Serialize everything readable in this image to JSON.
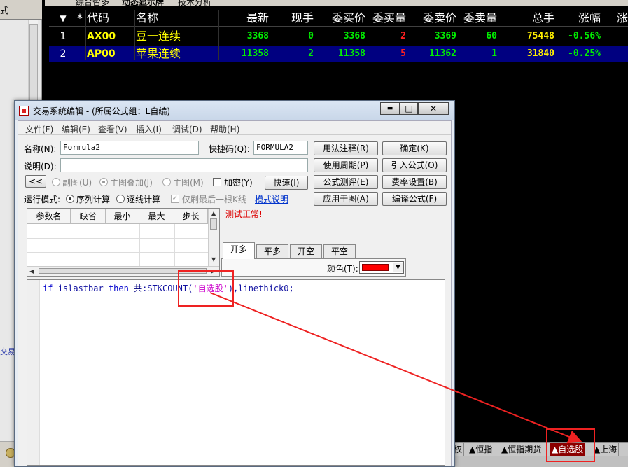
{
  "left_panel": {
    "top_label": "式",
    "side_label": "交易"
  },
  "top_tabs": [
    "综合智多",
    "动态显示牌",
    "技术分析"
  ],
  "quote_table": {
    "headers": {
      "idx": "",
      "star": "*",
      "code": "代码",
      "name": "名称",
      "new": "最新",
      "now": "现手",
      "bid": "委买价",
      "bid_vol": "委买量",
      "ask": "委卖价",
      "ask_vol": "委卖量",
      "total": "总手",
      "chg": "涨幅",
      "chg2": "涨"
    },
    "rows": [
      {
        "idx": "1",
        "code": "AX00",
        "name": "豆一连续",
        "new": "3368",
        "now": "0",
        "bid": "3368",
        "bid_vol": "2",
        "ask": "3369",
        "ask_vol": "60",
        "total": "75448",
        "chg": "-0.56%"
      },
      {
        "idx": "2",
        "code": "AP00",
        "name": "苹果连续",
        "new": "11358",
        "now": "2",
        "bid": "11358",
        "bid_vol": "5",
        "ask": "11362",
        "ask_vol": "1",
        "total": "31840",
        "chg": "-0.25%"
      }
    ]
  },
  "market_tabs": [
    "权",
    "▲恒指",
    "▲恒指期货",
    "▲自选股",
    "▲上海"
  ],
  "dialog": {
    "title": "交易系统编辑 - (所属公式组：L自编)",
    "win_buttons": {
      "minimize": "▬",
      "maximize": "□",
      "close": "✕"
    },
    "menu": [
      "文件(F)",
      "编辑(E)",
      "查看(V)",
      "插入(I)",
      "调试(D)",
      "帮助(H)"
    ],
    "name_label": "名称(N):",
    "name_value": "Formula2",
    "shortcut_label": "快捷码(Q):",
    "shortcut_value": "FORMULA2",
    "desc_label": "说明(D):",
    "desc_value": "",
    "btn_collapse": "<<",
    "radio_subchart": "副图(U)",
    "radio_overlay": "主图叠加(J)",
    "radio_main": "主图(M)",
    "chk_encrypt": "加密(Y)",
    "btn_quick": "快速(I)",
    "run_mode_label": "运行模式:",
    "radio_seq": "序列计算",
    "radio_tick": "逐线计算",
    "chk_last_bar": "仅刷最后一根K线",
    "link_mode": "模式说明",
    "status": "测试正常!",
    "right_buttons": [
      "用法注释(R)",
      "确定(K)",
      "使用周期(P)",
      "引入公式(O)",
      "公式测评(E)",
      "费率设置(B)",
      "应用于图(A)",
      "编译公式(F)"
    ],
    "param_headers": [
      "参数名",
      "缺省",
      "最小",
      "最大",
      "步长"
    ],
    "tabs": [
      "开多",
      "平多",
      "开空",
      "平空"
    ],
    "color_label": "颜色(T):",
    "code": {
      "kw_if": "if",
      "fn1": "islastbar",
      "kw_then": "then",
      "cn": "共",
      "fn2": ":STKCOUNT(",
      "str": "'自选股'",
      "tail": "),linethick0;"
    }
  },
  "colors": {
    "bg": "#000000",
    "code_yellow": "#ffff00",
    "up_red": "#ff2020",
    "down_green": "#00ee00",
    "selected_row": "#000080",
    "highlight": "#ee2222"
  }
}
